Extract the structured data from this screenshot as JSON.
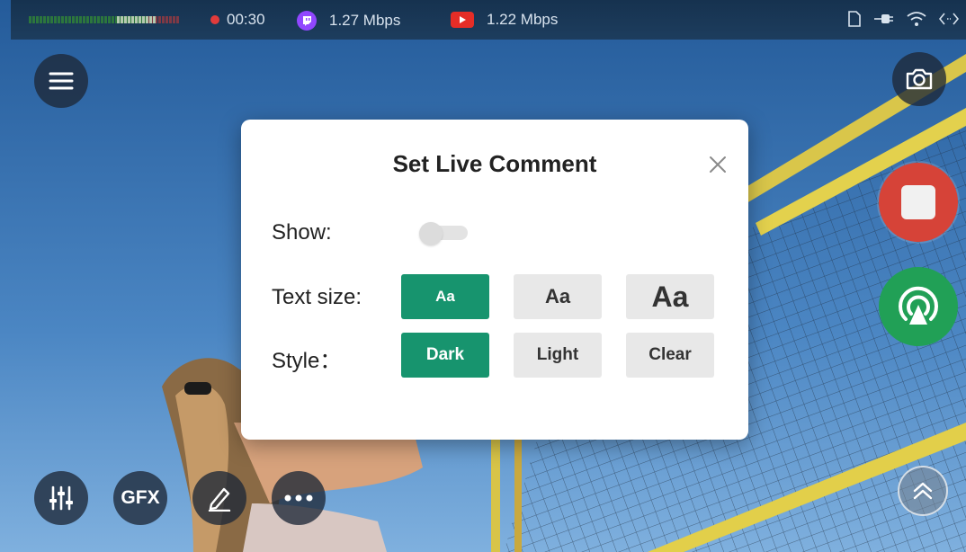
{
  "status_bar": {
    "timer": "00:30",
    "twitch_bitrate": "1.27 Mbps",
    "youtube_bitrate": "1.22 Mbps"
  },
  "bottom_controls": {
    "gfx_label": "GFX"
  },
  "dialog": {
    "title": "Set Live Comment",
    "show_label": "Show:",
    "show_enabled": false,
    "text_size_label": "Text size:",
    "text_size_options": [
      "Aa",
      "Aa",
      "Aa"
    ],
    "text_size_selected": "small",
    "style_label": "Style：",
    "style_options": [
      "Dark",
      "Light",
      "Clear"
    ],
    "style_selected": "Dark"
  },
  "colors": {
    "accent": "#17946e",
    "record": "#d64338",
    "live": "#21a056",
    "twitch": "#9147ff",
    "youtube": "#e52d27"
  }
}
